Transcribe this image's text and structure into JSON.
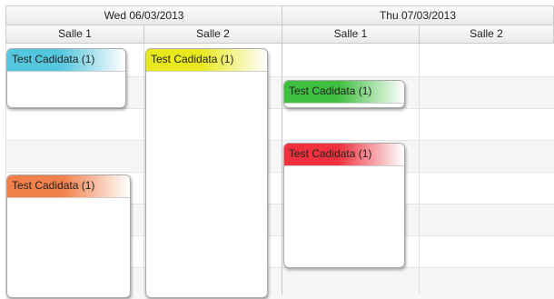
{
  "days": [
    {
      "label": "Wed 06/03/2013",
      "rooms": [
        "Salle 1",
        "Salle 2"
      ]
    },
    {
      "label": "Thu 07/03/2013",
      "rooms": [
        "Salle 1",
        "Salle 2"
      ]
    }
  ],
  "events": [
    {
      "title": "Test Cadidata (1)",
      "color": "#54c6dd"
    },
    {
      "title": "Test Cadidata (1)",
      "color": "#e8e81e"
    },
    {
      "title": "Test Cadidata (1)",
      "color": "#3fbf3f"
    },
    {
      "title": "Test Cadidata (1)",
      "color": "#f0313d"
    },
    {
      "title": "Test Cadidata (1)",
      "color": "#f2804a"
    }
  ]
}
